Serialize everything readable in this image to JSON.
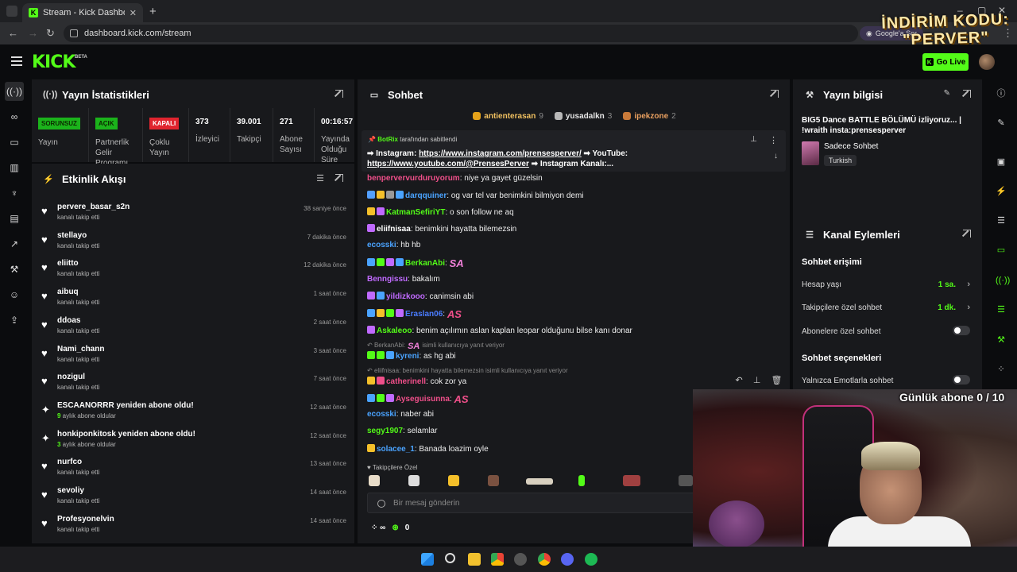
{
  "browser": {
    "tab_title": "Stream - Kick Dashboard",
    "url": "dashboard.kick.com/stream",
    "google_button": "Google'a Sor"
  },
  "promo_overlay": "İNDİRİM KODU: \"PERVER\"",
  "nav": {
    "logo": "KICK",
    "logo_badge": "BETA",
    "go_live": "Go Live"
  },
  "stats_panel": {
    "title": "Yayın İstatistikleri",
    "items": [
      {
        "badge": "SORUNSUZ",
        "label": "Yayın"
      },
      {
        "badge": "AÇIK",
        "label": "Partnerlik Gelir Programı"
      },
      {
        "badge": "KAPALI",
        "label": "Çoklu Yayın"
      },
      {
        "value": "373",
        "label": "İzleyici"
      },
      {
        "value": "39.001",
        "label": "Takipçi"
      },
      {
        "value": "271",
        "label": "Abone Sayısı"
      },
      {
        "value": "00:16:57",
        "label": "Yayında Olduğu Süre"
      }
    ]
  },
  "activity_panel": {
    "title": "Etkinlik Akışı",
    "items": [
      {
        "icon": "heart-icon",
        "name": "pervere_basar_s2n",
        "sub": "kanalı takip etti",
        "time": "38 saniye önce"
      },
      {
        "icon": "heart-icon",
        "name": "stellayo",
        "sub": "kanalı takip etti",
        "time": "7 dakika önce"
      },
      {
        "icon": "heart-icon",
        "name": "eliitto",
        "sub": "kanalı takip etti",
        "time": "12 dakika önce"
      },
      {
        "icon": "heart-icon",
        "name": "aibuq",
        "sub": "kanalı takip etti",
        "time": "1 saat önce"
      },
      {
        "icon": "heart-icon",
        "name": "ddoas",
        "sub": "kanalı takip etti",
        "time": "2 saat önce"
      },
      {
        "icon": "heart-icon",
        "name": "Nami_chann",
        "sub": "kanalı takip etti",
        "time": "3 saat önce"
      },
      {
        "icon": "heart-icon",
        "name": "nozigul",
        "sub": "kanalı takip etti",
        "time": "7 saat önce"
      },
      {
        "icon": "sparkle-icon",
        "name": "ESCAANORRR yeniden abone oldu!",
        "sub_hl": "9",
        "sub": " aylık abone oldular",
        "time": "12 saat önce"
      },
      {
        "icon": "sparkle-icon",
        "name": "honkiponkitosk yeniden abone oldu!",
        "sub_hl": "3",
        "sub": " aylık abone oldular",
        "time": "12 saat önce"
      },
      {
        "icon": "heart-icon",
        "name": "nurfco",
        "sub": "kanalı takip etti",
        "time": "13 saat önce"
      },
      {
        "icon": "heart-icon",
        "name": "sevoliy",
        "sub": "kanalı takip etti",
        "time": "14 saat önce"
      },
      {
        "icon": "heart-icon",
        "name": "Profesyonelvin",
        "sub": "kanalı takip etti",
        "time": "14 saat önce"
      }
    ]
  },
  "chat_panel": {
    "title": "Sohbet",
    "leaders": [
      {
        "name": "antienterasan",
        "count": "9",
        "color": "#e5a21a"
      },
      {
        "name": "yusadalkn",
        "count": "3",
        "color": "#b8b8b8"
      },
      {
        "name": "ipekzone",
        "count": "2",
        "color": "#c97a3a"
      }
    ],
    "pinned": {
      "author": "BotRix",
      "suffix": "tarafından sabitlendi",
      "text1": "➡ Instagram: ",
      "link1": "https://www.instagram.com/prensesperver/",
      "text2": " ➡ YouTube: ",
      "link2": "https://www.youtube.com/@PrensesPerver",
      "text3": " ➡ Instagram Kanalı:..."
    },
    "messages": [
      {
        "user": "benpervervurduruyorum",
        "color": "#f04f8a",
        "text": "niye ya gayet güzelsin"
      },
      {
        "user": "darqquiner",
        "color": "#4aa3ff",
        "text": "og var tel var benimkini bilmiyon demi"
      },
      {
        "user": "KatmanSefiriYT",
        "color": "#53fc18",
        "text": "o son follow ne aq"
      },
      {
        "user": "eliifnisaa",
        "color": "#ffffff",
        "text": "benimkini hayatta bilemezsin"
      },
      {
        "user": "ecosski",
        "color": "#4aa3ff",
        "text": "hb hb"
      },
      {
        "user": "BerkanAbi",
        "color": "#53fc18",
        "text": ""
      },
      {
        "user": "Benngissu",
        "color": "#c06aff",
        "text": "bakalım"
      },
      {
        "user": "yildizkooo",
        "color": "#c06aff",
        "text": "canimsin abi"
      },
      {
        "user": "Eraslan06",
        "color": "#4a7cff",
        "text": ""
      },
      {
        "user": "Askaleoo",
        "color": "#53fc18",
        "text": "benim açılımın aslan kaplan leopar olduğunu bilse kanı donar"
      },
      {
        "user": "kyreni",
        "color": "#4aa3ff",
        "text": "as hg abi"
      },
      {
        "user": "catherinell",
        "color": "#f04f8a",
        "text": "cok zor ya"
      },
      {
        "user": "Ayseguisunna",
        "color": "#f04f8a",
        "text": ""
      },
      {
        "user": "ecosski",
        "color": "#4aa3ff",
        "text": "naber abi"
      },
      {
        "user": "segy1907",
        "color": "#53fc18",
        "text": "selamlar"
      },
      {
        "user": "solacee_1",
        "color": "#4aa3ff",
        "text": "Banada loazim oyle"
      }
    ],
    "emote_text": {
      "sa": "SA",
      "as": "AS"
    },
    "replies": [
      {
        "user": "BerkanAbi:",
        "text": "isimli kullanıcıya yanıt veriyor"
      },
      {
        "user": "eliifnisaa:",
        "text": "benimkini hayatta bilemezsin isimli kullanıcıya yanıt veriyor"
      }
    ],
    "followers_only": "Takipçilere Özel",
    "input_placeholder": "Bir mesaj gönderin",
    "footer_infinity": "∞",
    "footer_count": "0"
  },
  "info_panel": {
    "title": "Yayın bilgisi",
    "stream_title": "BIG5 Dance BATTLE BÖLÜMÜ izliyoruz... | !wraith insta:prensesperver",
    "category": "Sadece Sohbet",
    "tag": "Turkish"
  },
  "actions_panel": {
    "title": "Kanal Eylemleri",
    "access_title": "Sohbet erişimi",
    "rows": [
      {
        "label": "Hesap yaşı",
        "value": "1 sa."
      },
      {
        "label": "Takipçilere özel sohbet",
        "value": "1 dk."
      },
      {
        "label": "Abonelere özel sohbet"
      }
    ],
    "options_title": "Sohbet seçenekleri",
    "emote_only": "Yalnızca Emotlarla sohbet"
  },
  "overlay_goal": "Günlük abone 0 / 10",
  "colors": {
    "accent": "#53fc18",
    "danger": "#e0242e",
    "panel": "#18191c"
  }
}
